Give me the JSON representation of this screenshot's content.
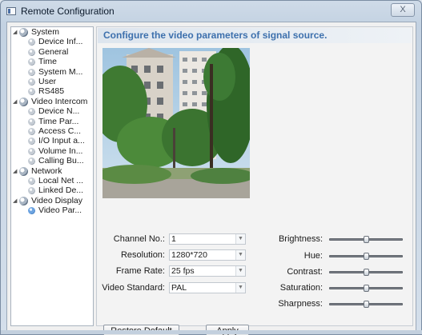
{
  "window": {
    "title": "Remote Configuration",
    "close_glyph": "X"
  },
  "tree": [
    {
      "label": "System",
      "type": "group",
      "expanded": true
    },
    {
      "label": "Device Inf...",
      "type": "leaf"
    },
    {
      "label": "General",
      "type": "leaf"
    },
    {
      "label": "Time",
      "type": "leaf"
    },
    {
      "label": "System M...",
      "type": "leaf"
    },
    {
      "label": "User",
      "type": "leaf"
    },
    {
      "label": "RS485",
      "type": "leaf"
    },
    {
      "label": "Video Intercom",
      "type": "group",
      "expanded": true
    },
    {
      "label": "Device N...",
      "type": "leaf"
    },
    {
      "label": "Time Par...",
      "type": "leaf"
    },
    {
      "label": "Access C...",
      "type": "leaf"
    },
    {
      "label": "I/O Input a...",
      "type": "leaf"
    },
    {
      "label": "Volume In...",
      "type": "leaf"
    },
    {
      "label": "Calling Bu...",
      "type": "leaf"
    },
    {
      "label": "Network",
      "type": "group",
      "expanded": true
    },
    {
      "label": "Local Net ...",
      "type": "leaf"
    },
    {
      "label": "Linked De...",
      "type": "leaf"
    },
    {
      "label": "Video Display",
      "type": "group",
      "expanded": true
    },
    {
      "label": "Video Par...",
      "type": "leaf",
      "selected": true
    }
  ],
  "panel": {
    "headline": "Configure the video parameters of signal source.",
    "fields": {
      "channel": {
        "label": "Channel No.:",
        "value": "1"
      },
      "resolution": {
        "label": "Resolution:",
        "value": "1280*720"
      },
      "frame_rate": {
        "label": "Frame Rate:",
        "value": "25 fps"
      },
      "video_standard": {
        "label": "Video Standard:",
        "value": "PAL"
      }
    },
    "sliders": [
      {
        "label": "Brightness:",
        "level": 0.5
      },
      {
        "label": "Hue:",
        "level": 0.5
      },
      {
        "label": "Contrast:",
        "level": 0.5
      },
      {
        "label": "Saturation:",
        "level": 0.5
      },
      {
        "label": "Sharpness:",
        "level": 0.5
      }
    ],
    "buttons": {
      "restore_default": "Restore Default S...",
      "apply": "Apply"
    }
  },
  "icons": {
    "expander": "expand-triangle-icon",
    "group": "gear-node-icon",
    "leaf": "bullet-node-icon",
    "combo_arrow": "chevron-down-icon"
  },
  "colors": {
    "headline_text": "#3d70ad",
    "selected_leaf_icon": "#2f6fb7"
  }
}
